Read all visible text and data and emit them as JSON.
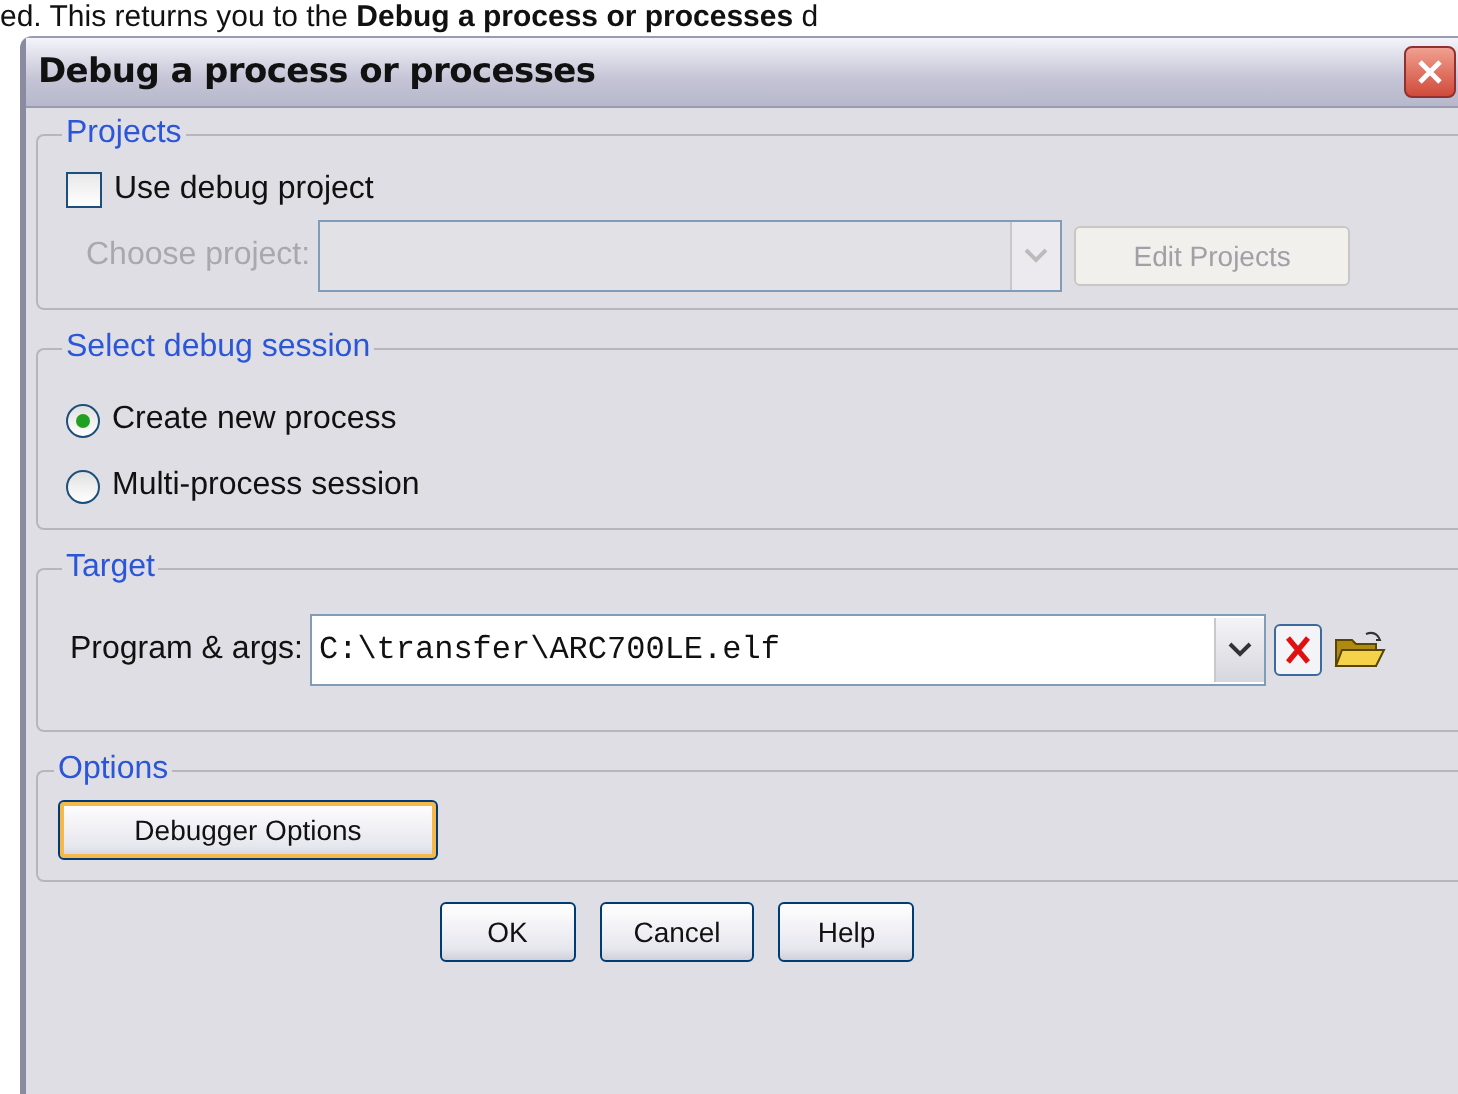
{
  "caption_text": "ed. This returns you to the **Debug a process or processes** d",
  "window": {
    "title": "Debug a process or processes"
  },
  "projects": {
    "legend": "Projects",
    "use_debug_project": {
      "label": "Use debug project",
      "checked": false
    },
    "choose_project": {
      "label": "Choose project:",
      "disabled": true
    },
    "edit_projects_button": {
      "label": "Edit Projects",
      "disabled": true
    }
  },
  "session": {
    "legend": "Select debug session",
    "options": [
      {
        "label": "Create new process",
        "selected": true
      },
      {
        "label": "Multi-process session",
        "selected": false
      }
    ]
  },
  "target": {
    "legend": "Target",
    "label": "Program & args:",
    "value": "C:\\transfer\\ARC700LE.elf"
  },
  "options": {
    "legend": "Options",
    "button": {
      "label": "Debugger Options",
      "focused": true
    }
  },
  "buttons": [
    "OK",
    "Cancel",
    "Help"
  ]
}
